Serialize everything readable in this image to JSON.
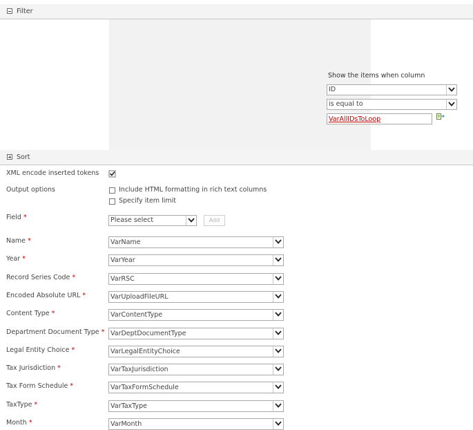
{
  "filter": {
    "header": "Filter",
    "condition_label": "Show the items when column",
    "column": "ID",
    "operator": "is equal to",
    "value": "VarAllIDsToLoop"
  },
  "sort": {
    "header": "Sort"
  },
  "xml_encode": {
    "label": "XML encode inserted tokens",
    "checked": true
  },
  "output_options": {
    "label": "Output options",
    "include_html": "Include HTML formatting in rich text columns",
    "item_limit": "Specify item limit"
  },
  "field": {
    "label": "Field",
    "required": "*",
    "placeholder": "Please select",
    "add_label": "Add"
  },
  "mappings": [
    {
      "label": "Name",
      "required": "*",
      "value": "VarName"
    },
    {
      "label": "Year",
      "required": "*",
      "value": "VarYear"
    },
    {
      "label": "Record Series Code",
      "required": "*",
      "value": "VarRSC"
    },
    {
      "label": "Encoded Absolute URL",
      "required": "*",
      "value": "VarUploadFileURL"
    },
    {
      "label": "Content Type",
      "required": "*",
      "value": "VarContentType"
    },
    {
      "label": "Department Document Type",
      "required": "*",
      "value": "VarDeptDocumentType"
    },
    {
      "label": "Legal Entity Choice",
      "required": "*",
      "value": "VarLegalEntityChoice"
    },
    {
      "label": "Tax Jurisdiction",
      "required": "*",
      "value": "VarTaxJurisdiction"
    },
    {
      "label": "Tax Form Schedule",
      "required": "*",
      "value": "VarTaxFormSchedule"
    },
    {
      "label": "TaxType",
      "required": "*",
      "value": "VarTaxType"
    },
    {
      "label": "Month",
      "required": "*",
      "value": "VarMonth"
    }
  ]
}
